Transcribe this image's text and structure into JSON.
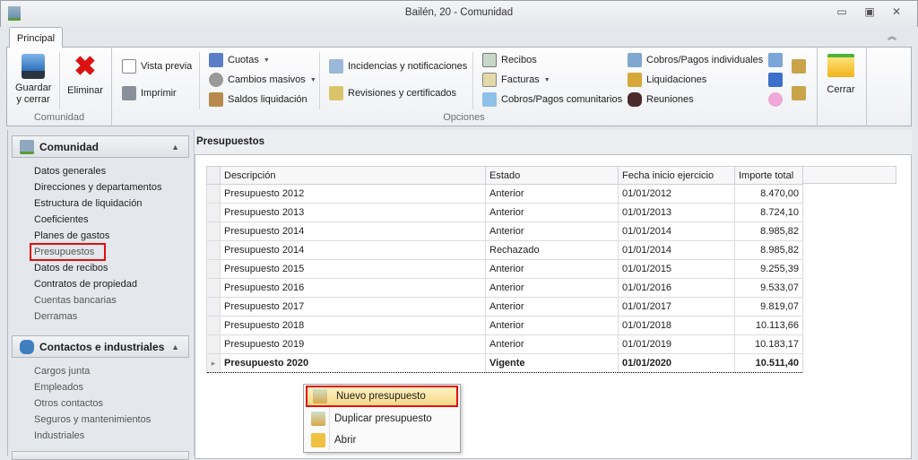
{
  "window": {
    "title": "Bailén, 20 - Comunidad"
  },
  "ribbon": {
    "tab": "Principal",
    "groups": {
      "comunidad": "Comunidad",
      "opciones": "Opciones"
    },
    "guardar": "Guardar\ny cerrar",
    "eliminar": "Eliminar",
    "vista_previa": "Vista previa",
    "imprimir": "Imprimir",
    "cuotas": "Cuotas",
    "cambios_masivos": "Cambios masivos",
    "saldos": "Saldos liquidación",
    "incidencias": "Incidencias y notificaciones",
    "revisiones": "Revisiones y certificados",
    "recibos": "Recibos",
    "facturas": "Facturas",
    "cobros_comunitarios": "Cobros/Pagos comunitarios",
    "cobros_individuales": "Cobros/Pagos individuales",
    "liquidaciones": "Liquidaciones",
    "reuniones": "Reuniones",
    "cerrar": "Cerrar"
  },
  "sidebar": {
    "sections": [
      {
        "title": "Comunidad",
        "items": [
          "Datos generales",
          "Direcciones y departamentos",
          "Estructura de liquidación",
          "Coeficientes",
          "Planes de gastos",
          "Presupuestos",
          "Datos de recibos",
          "Contratos de propiedad",
          "Cuentas bancarias",
          "Derramas"
        ]
      },
      {
        "title": "Contactos e industriales",
        "items": [
          "Cargos junta",
          "Empleados",
          "Otros contactos",
          "Seguros y mantenimientos",
          "Industriales"
        ]
      }
    ]
  },
  "main": {
    "title": "Presupuestos",
    "columns": [
      "Descripción",
      "Estado",
      "Fecha inicio ejercicio",
      "Importe total"
    ],
    "rows": [
      [
        "Presupuesto 2012",
        "Anterior",
        "01/01/2012",
        "8.470,00"
      ],
      [
        "Presupuesto 2013",
        "Anterior",
        "01/01/2013",
        "8.724,10"
      ],
      [
        "Presupuesto 2014",
        "Anterior",
        "01/01/2014",
        "8.985,82"
      ],
      [
        "Presupuesto 2014",
        "Rechazado",
        "01/01/2014",
        "8.985,82"
      ],
      [
        "Presupuesto 2015",
        "Anterior",
        "01/01/2015",
        "9.255,39"
      ],
      [
        "Presupuesto 2016",
        "Anterior",
        "01/01/2016",
        "9.533,07"
      ],
      [
        "Presupuesto 2017",
        "Anterior",
        "01/01/2017",
        "9.819,07"
      ],
      [
        "Presupuesto 2018",
        "Anterior",
        "01/01/2018",
        "10.113,66"
      ],
      [
        "Presupuesto 2019",
        "Anterior",
        "01/01/2019",
        "10.183,17"
      ],
      [
        "Presupuesto 2020",
        "Vigente",
        "01/01/2020",
        "10.511,40"
      ]
    ]
  },
  "context_menu": {
    "items": [
      "Nuevo presupuesto",
      "Duplicar presupuesto",
      "Abrir"
    ]
  }
}
